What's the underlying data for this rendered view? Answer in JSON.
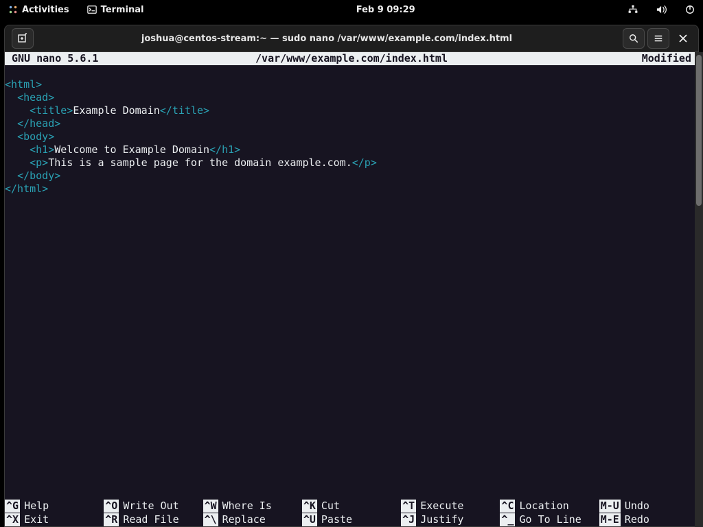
{
  "topbar": {
    "activities": "Activities",
    "app": "Terminal",
    "clock": "Feb 9  09:29"
  },
  "window": {
    "title": "joshua@centos-stream:~ — sudo nano /var/www/example.com/index.html"
  },
  "nano": {
    "version": "GNU nano 5.6.1",
    "filepath": "/var/www/example.com/index.html",
    "status": "Modified",
    "content": {
      "l1": "<html>",
      "l2_indent": "  ",
      "l2": "<head>",
      "l3_indent": "    ",
      "l3_open": "<title>",
      "l3_text": "Example Domain",
      "l3_close": "</title>",
      "l4_indent": "  ",
      "l4": "</head>",
      "l5_indent": "  ",
      "l5": "<body>",
      "l6_indent": "    ",
      "l6_open": "<h1>",
      "l6_text": "Welcome to Example Domain",
      "l6_close": "</h1>",
      "l7_indent": "    ",
      "l7_open": "<p>",
      "l7_text": "This is a sample page for the domain example.com.",
      "l7_close": "</p>",
      "l8_indent": "  ",
      "l8": "</body>",
      "l9": "</html>"
    },
    "shortcuts": [
      {
        "k1": "^G",
        "l1": "Help",
        "k2": "^X",
        "l2": "Exit"
      },
      {
        "k1": "^O",
        "l1": "Write Out",
        "k2": "^R",
        "l2": "Read File"
      },
      {
        "k1": "^W",
        "l1": "Where Is",
        "k2": "^\\",
        "l2": "Replace"
      },
      {
        "k1": "^K",
        "l1": "Cut",
        "k2": "^U",
        "l2": "Paste"
      },
      {
        "k1": "^T",
        "l1": "Execute",
        "k2": "^J",
        "l2": "Justify"
      },
      {
        "k1": "^C",
        "l1": "Location",
        "k2": "^_",
        "l2": "Go To Line"
      },
      {
        "k1": "M-U",
        "l1": "Undo",
        "k2": "M-E",
        "l2": "Redo"
      }
    ]
  }
}
